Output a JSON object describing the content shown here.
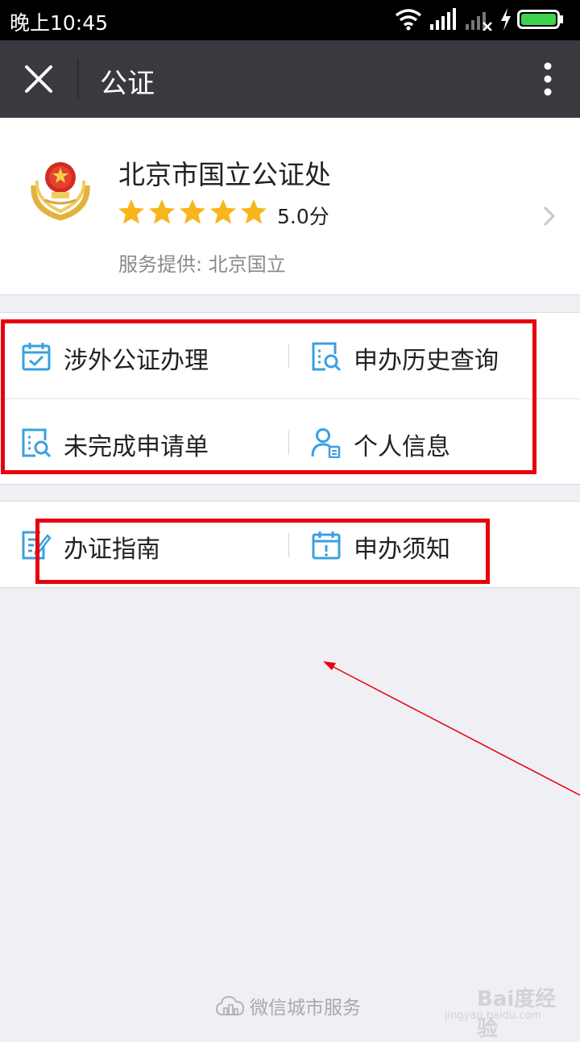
{
  "status_bar": {
    "time": "晚上10:45",
    "icons": [
      "wifi-icon",
      "signal-icon",
      "signal-empty-icon",
      "charging-icon",
      "battery-icon"
    ]
  },
  "title_bar": {
    "title": "公证",
    "close_icon": "close-icon",
    "more_icon": "more-vertical-icon"
  },
  "org": {
    "name": "北京市国立公证处",
    "rating_stars": 5,
    "score": "5.0分",
    "provider": "服务提供: 北京国立",
    "logo_icon": "national-emblem-icon"
  },
  "menu": {
    "group1": [
      {
        "label": "涉外公证办理",
        "icon": "calendar-check-icon"
      },
      {
        "label": "申办历史查询",
        "icon": "document-search-icon"
      },
      {
        "label": "未完成申请单",
        "icon": "document-search-icon"
      },
      {
        "label": "个人信息",
        "icon": "user-card-icon"
      }
    ],
    "group2": [
      {
        "label": "办证指南",
        "icon": "document-edit-icon"
      },
      {
        "label": "申办须知",
        "icon": "calendar-alert-icon"
      }
    ]
  },
  "footer": {
    "text": "微信城市服务",
    "icon": "cloud-city-icon"
  },
  "watermark": {
    "text": "Bai度经验",
    "sub": "jingyan.baidu.com"
  },
  "colors": {
    "accent_icon": "#3aa0e0",
    "star": "#f8b51c",
    "annotation": "#e8000d",
    "title_bar": "#393a3f"
  }
}
